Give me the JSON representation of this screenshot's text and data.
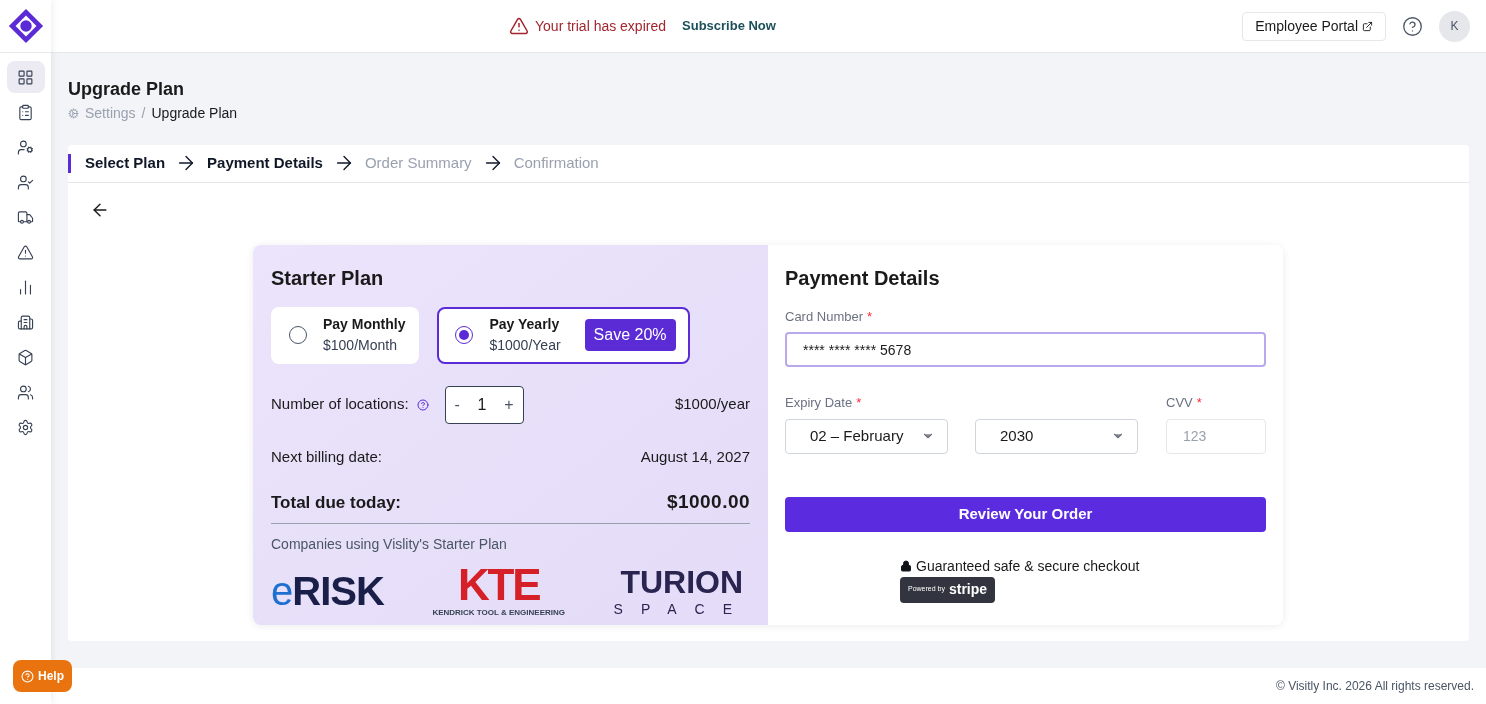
{
  "sidebar": {
    "items": [
      {
        "selected": true
      },
      {
        "selected": false
      },
      {
        "selected": false
      },
      {
        "selected": false
      },
      {
        "selected": false
      },
      {
        "selected": false
      },
      {
        "selected": false
      },
      {
        "selected": false
      },
      {
        "selected": false
      },
      {
        "selected": false
      },
      {
        "selected": false
      }
    ]
  },
  "header": {
    "trial_notice": "Your trial has expired",
    "subscribe_link": "Subscribe Now",
    "portal_button": "Employee Portal",
    "avatar": "K"
  },
  "page": {
    "title": "Upgrade Plan",
    "breadcrumb": [
      "Settings",
      "/",
      "Upgrade Plan"
    ]
  },
  "steps": [
    {
      "label": "Select Plan",
      "done": true
    },
    {
      "label": "Payment Details",
      "done": true
    },
    {
      "label": "Order Summary",
      "done": false
    },
    {
      "label": "Confirmation",
      "done": false
    }
  ],
  "plan": {
    "title": "Starter Plan",
    "options": [
      {
        "label": "Pay Monthly",
        "price": "$100/Month",
        "selected": false
      },
      {
        "label": "Pay Yearly",
        "price": "$1000/Year",
        "selected": true,
        "badge": "Save 20%"
      }
    ],
    "locations_label": "Number of locations:",
    "locations": "1",
    "minus": "-",
    "plus": "+",
    "locations_price": "$1000/year",
    "billing_label": "Next billing date:",
    "billing_date": "August 14, 2027",
    "total_label": "Total due today:",
    "total": "$1000.00",
    "companies_caption": "Companies using Vislity's Starter Plan",
    "logos": [
      {
        "kind": "erisk",
        "text": "eRISK"
      },
      {
        "kind": "kte",
        "text": "KTE",
        "subtitle": "KENDRICK TOOL & ENGINEERING"
      },
      {
        "kind": "turion",
        "text": "TURION",
        "subtitle": "SPACE"
      }
    ]
  },
  "payment": {
    "title": "Payment Details",
    "card_label": "Card Number",
    "required": "*",
    "card_value": "**** **** **** 5678",
    "expiry_label": "Expiry Date",
    "month": "02 – February",
    "year": "2030",
    "cvv_label": "CVV",
    "cvv_placeholder": "123",
    "submit": "Review Your Order",
    "secure_note": "Guaranteed safe & secure checkout",
    "powered_by": "Powered by",
    "stripe": "stripe"
  },
  "help_button": "Help",
  "footer": "© Visitly Inc. 2026 All rights reserved."
}
